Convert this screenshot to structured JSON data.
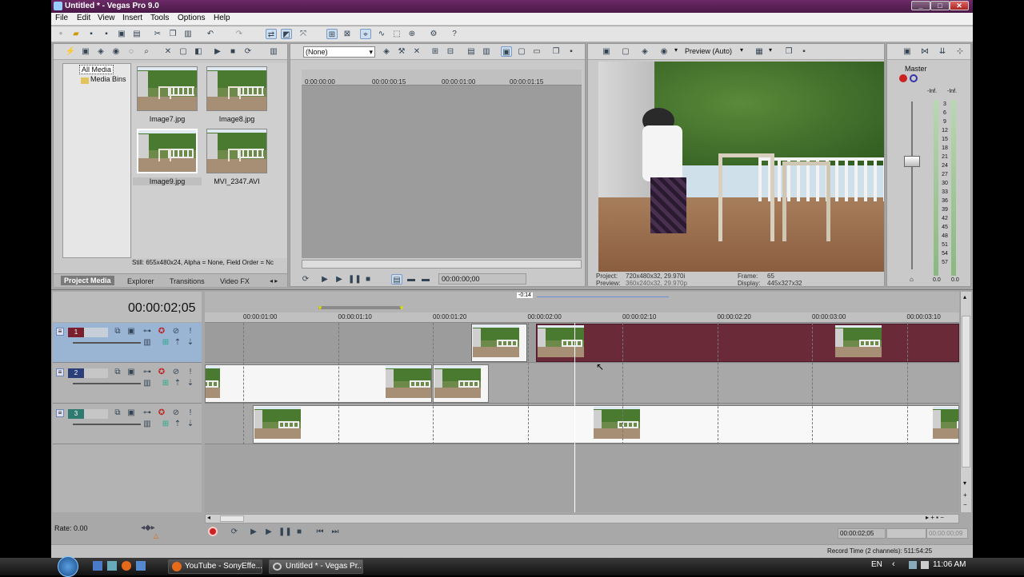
{
  "window": {
    "title": "Untitled * - Vegas Pro 9.0",
    "min": "_",
    "max": "□",
    "close": "✕"
  },
  "menu": [
    "File",
    "Edit",
    "View",
    "Insert",
    "Tools",
    "Options",
    "Help"
  ],
  "explorer": {
    "tree": [
      "All Media",
      "Media Bins"
    ],
    "items": [
      {
        "name": "Image7.jpg"
      },
      {
        "name": "Image8.jpg"
      },
      {
        "name": "Image9.jpg"
      },
      {
        "name": "MVI_2347.AVI"
      }
    ],
    "status": "Still: 655x480x24, Alpha = None, Field Order = Nc"
  },
  "tabs": [
    "Project Media",
    "Explorer",
    "Transitions",
    "Video FX"
  ],
  "trimmer": {
    "dropdown": "(None)",
    "ticks": [
      "0:00:00:00",
      "00:00:00:15",
      "00:00:01:00",
      "00:00:01:15"
    ],
    "timecode": "00:00:00;00"
  },
  "preview": {
    "mode": "Preview (Auto)",
    "project_label": "Project:",
    "project_value": "720x480x32, 29.970i",
    "preview_label": "Preview:",
    "preview_value": "360x240x32, 29.970p",
    "frame_label": "Frame:",
    "frame_value": "65",
    "display_label": "Display:",
    "display_value": "445x327x32"
  },
  "mixer": {
    "title": "Master",
    "inf_left": "-Inf.",
    "inf_right": "-Inf.",
    "scale": [
      "3",
      "6",
      "9",
      "12",
      "15",
      "18",
      "21",
      "24",
      "27",
      "30",
      "33",
      "36",
      "39",
      "42",
      "45",
      "48",
      "51",
      "54",
      "57"
    ],
    "bottom_left": "0.0",
    "bottom_right": "0.0"
  },
  "timeline": {
    "timecode": "00:00:02;05",
    "loop_label": "-0:14",
    "ruler": [
      "00:00:01:00",
      "00:00:01:10",
      "00:00:01:20",
      "00:00:02:00",
      "00:00:02:10",
      "00:00:02:20",
      "00:00:03:00",
      "00:00:03:10"
    ],
    "tracks": [
      {
        "num": "1",
        "color": "#7a1f2e"
      },
      {
        "num": "2",
        "color": "#2a3f7a"
      },
      {
        "num": "3",
        "color": "#2f7a70"
      }
    ],
    "rate": "Rate: 0.00",
    "pos_time": "00:00:02;05",
    "end_time": "00:00:00;09",
    "record_time": "Record Time (2 channels): 511:54:25"
  },
  "taskbar": {
    "items": [
      "YouTube - SonyEffe...",
      "Untitled * - Vegas Pr..."
    ],
    "lang": "EN",
    "clock": "11:06 AM"
  }
}
